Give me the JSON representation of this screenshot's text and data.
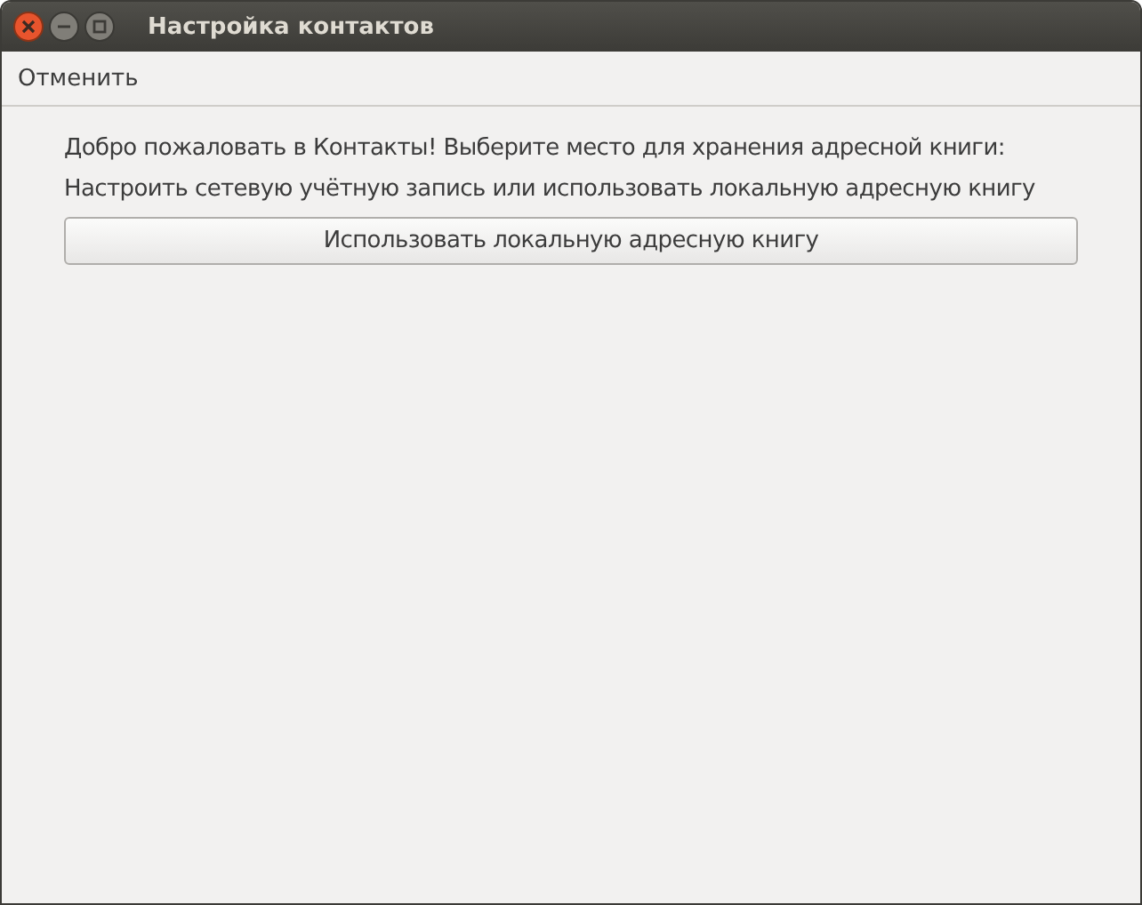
{
  "window": {
    "title": "Настройка контактов"
  },
  "header_bar": {
    "cancel": "Отменить"
  },
  "content": {
    "welcome": "Добро пожаловать в Контакты! Выберите место для хранения адресной книги:",
    "hint": "Настроить сетевую учётную запись или использовать локальную адресную книгу",
    "button": "Использовать локальную адресную книгу"
  }
}
